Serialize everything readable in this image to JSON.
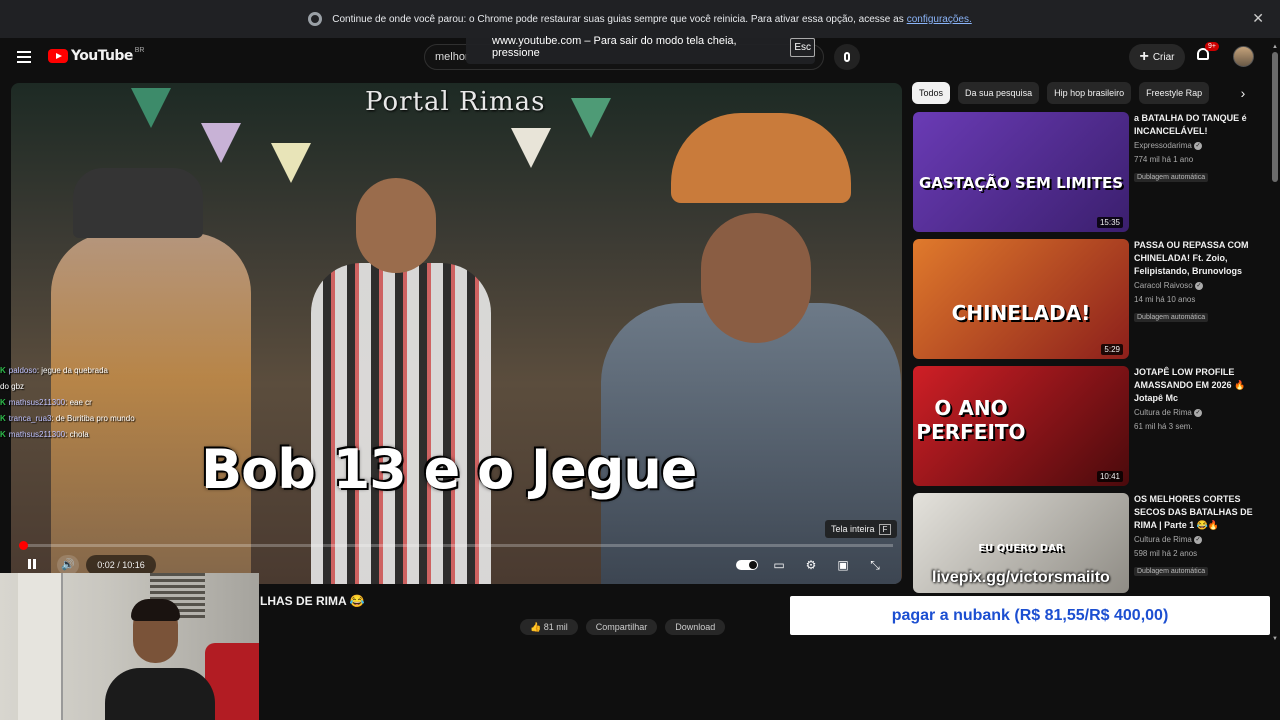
{
  "infobar": {
    "message": "Continue de onde você parou: o Chrome pode restaurar suas guias sempre que você reinicia. Para ativar essa opção, acesse as",
    "link": "configurações."
  },
  "header": {
    "logo_text": "YouTube",
    "region": "BR",
    "search_value": "melhor",
    "create_label": "Criar",
    "notifications_badge": "9+"
  },
  "fullscreen_toast": {
    "message": "www.youtube.com – Para sair do modo tela cheia, pressione",
    "key": "Esc"
  },
  "player": {
    "watermark": "Portal Rimas",
    "caption": "Bob 13 e o Jegue",
    "fullscreen_hint": "Tela inteira",
    "fullscreen_key": "F",
    "time": "0:02 / 10:16",
    "progress_fraction": 0.003
  },
  "chat": [
    {
      "user": "paldoso",
      "text": ": jegue da quebrada"
    },
    {
      "user": "",
      "text": "do gbz"
    },
    {
      "user": "mathsus211300",
      "text": ": eae cr"
    },
    {
      "user": "tranca_rua3",
      "text": ": de Buritiba pro mundo"
    },
    {
      "user": "mathsus211300",
      "text": ": chola"
    }
  ],
  "chips": [
    "Todos",
    "Da sua pesquisa",
    "Hip hop brasileiro",
    "Freestyle Rap"
  ],
  "videos": [
    {
      "title": "a BATALHA DO TANQUE é INCANCELÁVEL!",
      "channel": "Expressodarima",
      "meta": "774 mil  há 1 ano",
      "badge": "Dublagem automática",
      "duration": "15:35",
      "thumb_text": "GASTAÇÃO SEM LIMITES",
      "bg": "#5b2f9c"
    },
    {
      "title": "PASSA OU REPASSA COM CHINELADA! Ft. Zoio, Felipistando, Brunovlogs",
      "channel": "Caracol Raivoso",
      "meta": "14 mi  há 10 anos",
      "badge": "Dublagem automática",
      "duration": "5:29",
      "thumb_text": "CHINELADA!",
      "bg": "#c8432a"
    },
    {
      "title": "JOTAPÊ LOW PROFILE AMASSANDO EM 2026 🔥 Jotapê Mc",
      "channel": "Cultura de Rima",
      "meta": "61 mil  há 3 sem.",
      "badge": "",
      "duration": "10:41",
      "thumb_text": "O ANO PERFEITO",
      "bg": "#b3161c"
    },
    {
      "title": "OS MELHORES CORTES SECOS DAS BATALHAS DE RIMA | Parte 1 😂🔥",
      "channel": "Cultura de Rima",
      "meta": "598 mil  há 2 anos",
      "badge": "Dublagem automática",
      "duration": "",
      "thumb_text": "EU QUERO DAR",
      "bg": "#d9d7d2"
    }
  ],
  "below": {
    "title_fragment": "LHAS DE RIMA 😂",
    "likes": "81 mil",
    "share": "Compartilhar",
    "more": "Download"
  },
  "overlay": {
    "pix_text": "livepix.gg/victorsmaiito",
    "donation": "pagar a nubank (R$ 81,55/R$ 400,00)"
  }
}
